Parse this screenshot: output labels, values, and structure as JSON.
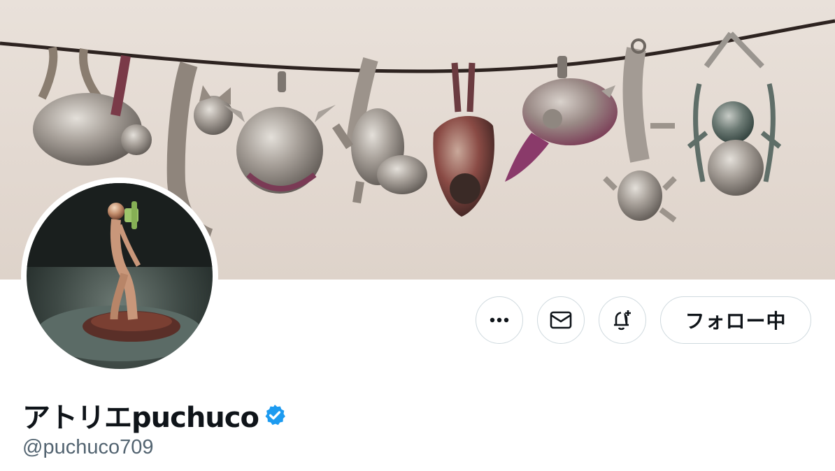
{
  "profile": {
    "display_name": "アトリエpuchuco",
    "handle": "@puchuco709",
    "verified": true
  },
  "actions": {
    "more_icon": "more-icon",
    "message_icon": "mail-icon",
    "notify_icon": "bell-plus-icon",
    "follow_label": "フォロー中"
  },
  "banner": {
    "subject": "silver animal pendants hanging on a cord",
    "icon": "banner-image"
  },
  "avatar": {
    "icon": "avatar-image"
  },
  "colors": {
    "verified_blue": "#1d9bf0",
    "text_primary": "#0f1419",
    "text_secondary": "#536471",
    "border": "#cfd9de"
  }
}
